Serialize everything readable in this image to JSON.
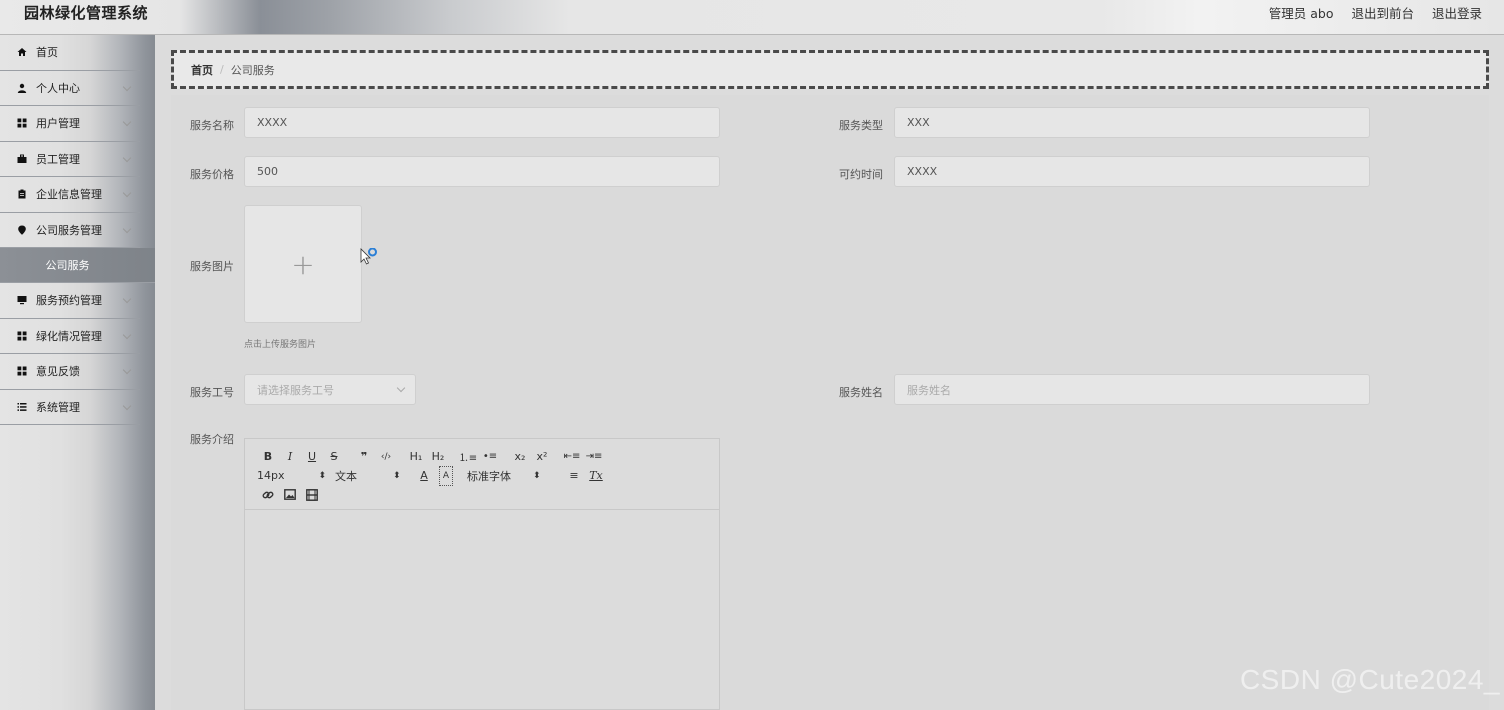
{
  "app_title": "园林绿化管理系统",
  "top_links": {
    "admin": "管理员 abo",
    "frontend": "退出到前台",
    "logout": "退出登录"
  },
  "sidebar": {
    "items": [
      {
        "label": "首页",
        "icon": "home-icon"
      },
      {
        "label": "个人中心",
        "icon": "user-icon"
      },
      {
        "label": "用户管理",
        "icon": "grid-icon"
      },
      {
        "label": "员工管理",
        "icon": "briefcase-icon"
      },
      {
        "label": "企业信息管理",
        "icon": "clipboard-icon"
      },
      {
        "label": "公司服务管理",
        "icon": "map-marker-icon"
      },
      {
        "label": "服务预约管理",
        "icon": "monitor-icon"
      },
      {
        "label": "绿化情况管理",
        "icon": "grid-icon"
      },
      {
        "label": "意见反馈",
        "icon": "grid-icon"
      },
      {
        "label": "系统管理",
        "icon": "list-icon"
      }
    ],
    "active_sub": "公司服务"
  },
  "breadcrumb": {
    "home": "首页",
    "separator": "/",
    "current": "公司服务"
  },
  "form": {
    "name_label": "服务名称",
    "name_value": "XXXX",
    "type_label": "服务类型",
    "type_value": "XXX",
    "price_label": "服务价格",
    "price_value": "500",
    "time_label": "可约时间",
    "time_value": "XXXX",
    "image_label": "服务图片",
    "upload_plus": "+",
    "upload_hint": "点击上传服务图片",
    "staffno_label": "服务工号",
    "staffno_placeholder": "请选择服务工号",
    "staffname_label": "服务姓名",
    "staffname_placeholder": "服务姓名",
    "intro_label": "服务介绍"
  },
  "editor": {
    "bold": "B",
    "italic": "I",
    "underline": "U",
    "strike": "S",
    "quote": "❞",
    "code": "‹/›",
    "h1": "H₁",
    "h2": "H₂",
    "ol": "⒈≡",
    "ul": "•≡",
    "sub": "x₂",
    "sup": "x²",
    "outdent": "⇤≡",
    "indent": "⇥≡",
    "size": "14px",
    "header": "文本",
    "font": "标准字体",
    "color": "A",
    "background": "A",
    "align": "≡",
    "clean": "Tx"
  },
  "watermark": "CSDN @Cute2024_"
}
